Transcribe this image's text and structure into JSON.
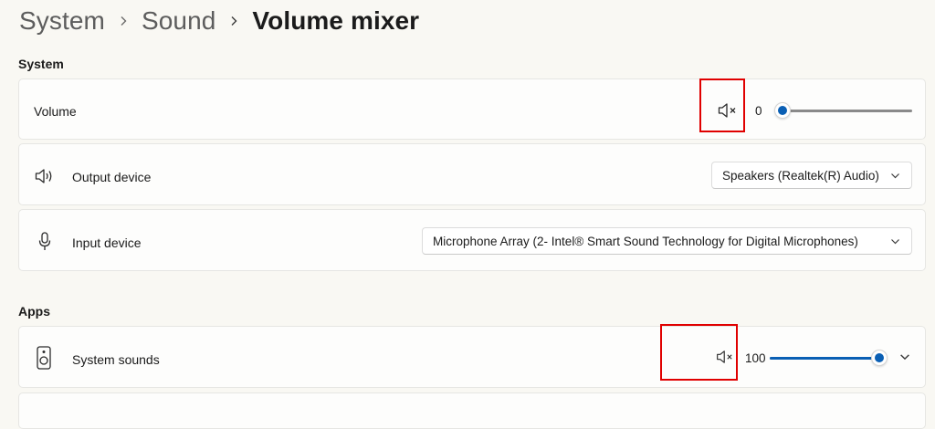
{
  "breadcrumb": {
    "items": [
      "System",
      "Sound",
      "Volume mixer"
    ]
  },
  "system_section": {
    "title": "System",
    "volume": {
      "label": "Volume",
      "value": "0",
      "level": 0
    },
    "output_device": {
      "label": "Output device",
      "selected": "Speakers (Realtek(R) Audio)"
    },
    "input_device": {
      "label": "Input device",
      "selected": "Microphone Array (2- Intel® Smart Sound Technology for Digital Microphones)"
    }
  },
  "apps_section": {
    "title": "Apps",
    "system_sounds": {
      "label": "System sounds",
      "value": "100",
      "level": 1
    }
  },
  "colors": {
    "accent": "#0a5fb4",
    "highlight_box": "#e00000"
  },
  "icons": {
    "mute": "speaker-muted-icon",
    "output": "speaker-icon",
    "input": "microphone-icon",
    "app": "speaker-box-icon",
    "breadcrumb_sep": "chevron-right-icon",
    "dropdown": "chevron-down-icon",
    "expand": "chevron-down-icon"
  }
}
